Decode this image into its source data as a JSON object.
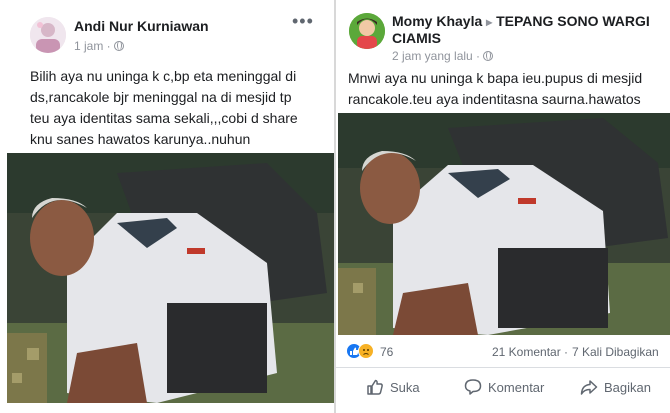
{
  "post_left": {
    "author": "Andi Nur Kurniawan",
    "time": "1 jam ·",
    "more_icon": "more-icon",
    "text": "Bilih aya nu uninga k c,bp eta meninggal di\nds,rancakole bjr meninggal na di mesjid tp\nteu aya identitas sama sekali,,,cobi d share\nknu sanes hawatos karunya..nuhun"
  },
  "post_right": {
    "author": "Momy Khayla",
    "arrow": "▸",
    "group": "TEPANG SONO WARGI",
    "group_line2": "CIAMIS",
    "time": "2 jam yang lalu ·",
    "text": "Mnwi aya nu uninga k bapa ieu.pupus di mesjid\nrancakole.teu aya indentitasna saurna.hawatos",
    "reaction_count": "76",
    "comments": "21 Komentar",
    "separator": "·",
    "shares": "7 Kali Dibagikan",
    "actions": {
      "like": "Suka",
      "comment": "Komentar",
      "share": "Bagikan"
    }
  },
  "colors": {
    "like_blue": "#1877f2",
    "haha_yellow": "#f7b125",
    "text": "#1c1e21",
    "muted": "#90949c"
  }
}
